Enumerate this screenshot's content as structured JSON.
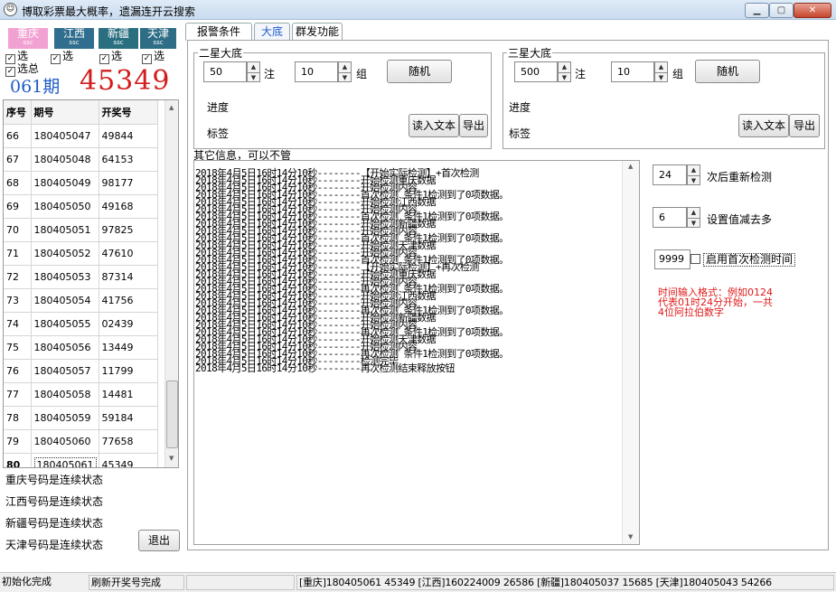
{
  "window": {
    "title": "博取彩票最大概率，遗漏连开云搜索",
    "icon": "app-face-icon"
  },
  "provinces": [
    {
      "name": "重庆",
      "sub": "ssc",
      "color": "#f2a2d2"
    },
    {
      "name": "江西",
      "sub": "ssc",
      "color": "#2f6e8e"
    },
    {
      "name": "新疆",
      "sub": "ssc",
      "color": "#2a6f80"
    },
    {
      "name": "天津",
      "sub": "ssc",
      "color": "#2d6d86"
    }
  ],
  "checks": {
    "select": "选",
    "select_all": "选总"
  },
  "latest": {
    "period": "061期",
    "number": "45349"
  },
  "table": {
    "headers": [
      "序号",
      "期号",
      "开奖号"
    ],
    "rows": [
      [
        "66",
        "180405047",
        "49844"
      ],
      [
        "67",
        "180405048",
        "64153"
      ],
      [
        "68",
        "180405049",
        "98177"
      ],
      [
        "69",
        "180405050",
        "49168"
      ],
      [
        "70",
        "180405051",
        "97825"
      ],
      [
        "71",
        "180405052",
        "47610"
      ],
      [
        "72",
        "180405053",
        "87314"
      ],
      [
        "73",
        "180405054",
        "41756"
      ],
      [
        "74",
        "180405055",
        "02439"
      ],
      [
        "75",
        "180405056",
        "13449"
      ],
      [
        "76",
        "180405057",
        "11799"
      ],
      [
        "77",
        "180405058",
        "14481"
      ],
      [
        "78",
        "180405059",
        "59184"
      ],
      [
        "79",
        "180405060",
        "77658"
      ],
      [
        "80",
        "180405061",
        "45349"
      ]
    ]
  },
  "status_lines": [
    "重庆号码是连续状态",
    "江西号码是连续状态",
    "新疆号码是连续状态",
    "天津号码是连续状态"
  ],
  "exit_label": "退出",
  "tabs": [
    "报警条件",
    "大底",
    "群发功能"
  ],
  "two_star": {
    "legend": "二星大底",
    "count": "50",
    "count_unit": "注",
    "groups": "10",
    "groups_unit": "组",
    "random_label": "随机",
    "progress_label": "进度",
    "tag_label": "标签",
    "read_text": "读入文本",
    "export": "导出"
  },
  "three_star": {
    "legend": "三星大底",
    "count": "500",
    "count_unit": "注",
    "groups": "10",
    "groups_unit": "组",
    "random_label": "随机",
    "progress_label": "进度",
    "tag_label": "标签",
    "read_text": "读入文本",
    "export": "导出"
  },
  "log": {
    "title": "其它信息，可以不管",
    "lines": [
      "2018年4月5日16时14分10秒--------【开始实际检测】+首次检测",
      "2018年4月5日16时14分10秒--------开始检测重庆数据",
      "2018年4月5日16时14分10秒--------开始检测内容",
      "2018年4月5日16时14分10秒--------首次检测 条件1检测到了0项数据。",
      "2018年4月5日16时14分10秒--------开始检测江西数据",
      "2018年4月5日16时14分10秒--------开始检测内容",
      "2018年4月5日16时14分10秒--------首次检测 条件1检测到了0项数据。",
      "2018年4月5日16时14分10秒--------开始检测新疆数据",
      "2018年4月5日16时14分10秒--------开始检测内容",
      "2018年4月5日16时14分10秒--------首次检测 条件1检测到了0项数据。",
      "2018年4月5日16时14分10秒--------开始检测天津数据",
      "2018年4月5日16时14分10秒--------开始检测内容",
      "2018年4月5日16时14分10秒--------首次检测 条件1检测到了0项数据。",
      "2018年4月5日16时14分10秒--------【开始实际检测】+再次检测",
      "2018年4月5日16时14分10秒--------开始检测重庆数据",
      "2018年4月5日16时14分10秒--------开始检测内容",
      "2018年4月5日16时14分10秒--------再次检测 条件1检测到了0项数据。",
      "2018年4月5日16时14分10秒--------开始检测江西数据",
      "2018年4月5日16时14分10秒--------开始检测内容",
      "2018年4月5日16时14分10秒--------再次检测 条件1检测到了0项数据。",
      "2018年4月5日16时14分10秒--------开始检测新疆数据",
      "2018年4月5日16时14分10秒--------开始检测内容",
      "2018年4月5日16时14分10秒--------再次检测 条件1检测到了0项数据。",
      "2018年4月5日16时14分10秒--------开始检测天津数据",
      "2018年4月5日16时14分10秒--------开始检测内容",
      "2018年4月5日16时14分10秒--------再次检测 条件1检测到了0项数据。",
      "2018年4月5日16时14分10秒--------检测完毕",
      "2018年4月5日16时14分10秒--------再次检测结束释放按钮"
    ]
  },
  "options": {
    "recheck_value": "24",
    "recheck_label": "次后重新检测",
    "reduce_value": "6",
    "reduce_label": "设置值减去多",
    "time_value": "9999",
    "time_label": "启用首次检测时间",
    "hint_lines": [
      "时间输入格式：例如0124",
      "代表01时24分开始，一共",
      "4位阿拉伯数字"
    ]
  },
  "statusbar": [
    "初始化完成",
    "刷新开奖号完成",
    "",
    "[重庆]180405061 45349 [江西]160224009 26586 [新疆]180405037 15685 [天津]180405043 54266"
  ]
}
